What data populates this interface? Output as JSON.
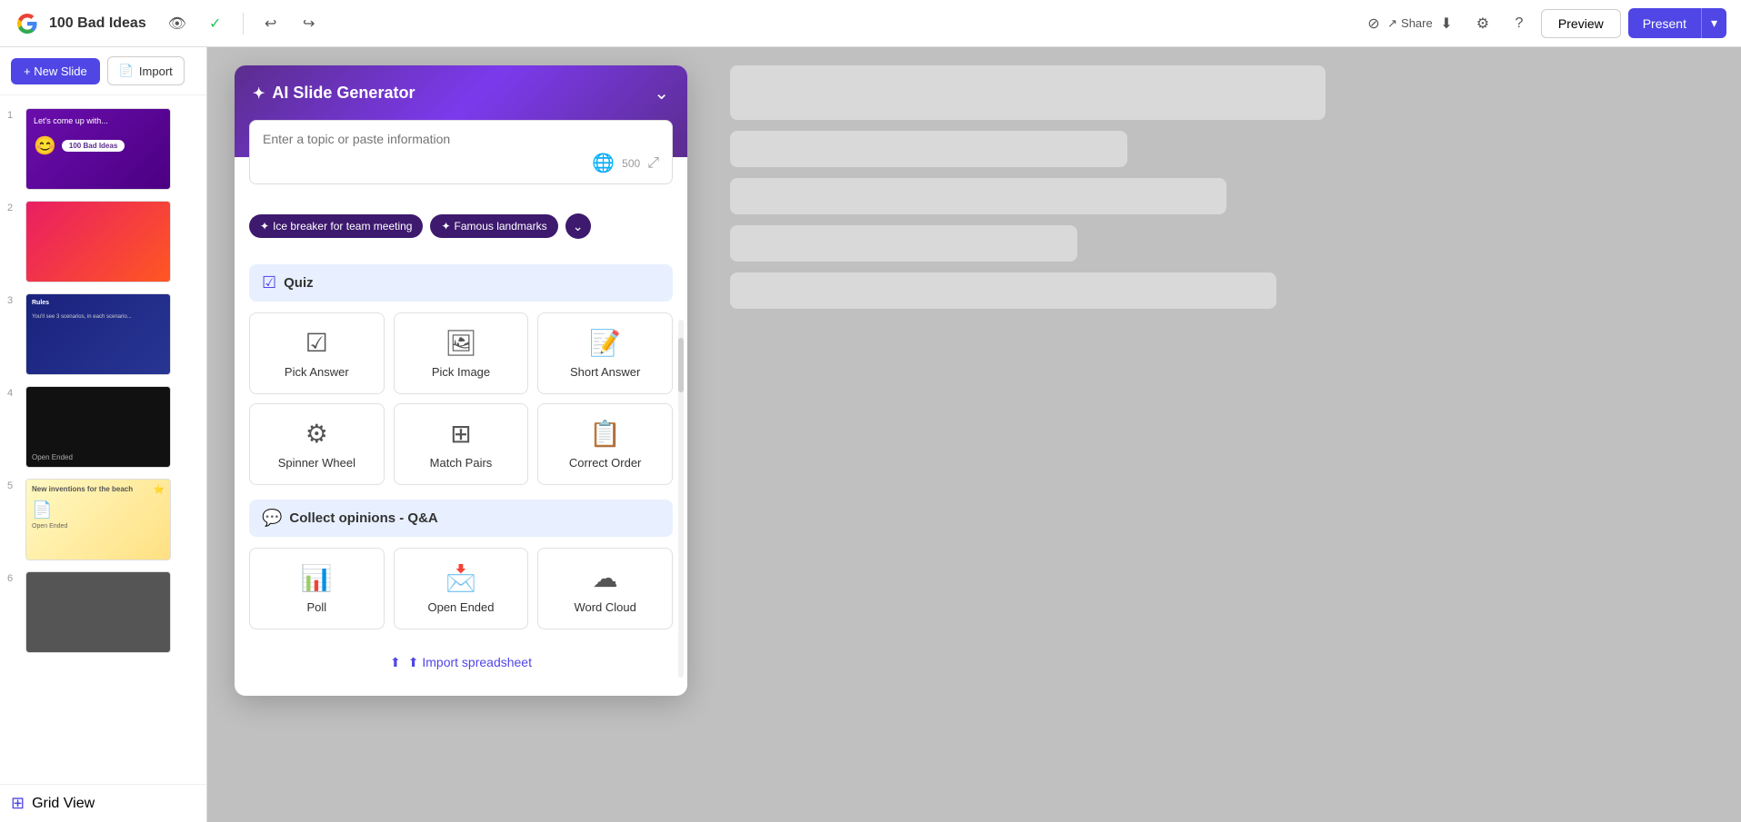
{
  "app": {
    "title": "100 Bad Ideas",
    "logo_text": "G"
  },
  "topbar": {
    "undo_label": "↩",
    "redo_label": "↪",
    "eye_label": "👁",
    "check_label": "✓",
    "share_label": "Share",
    "preview_label": "Preview",
    "present_label": "Present"
  },
  "sidebar": {
    "new_slide_label": "+ New Slide",
    "import_label": "Import",
    "grid_view_label": "Grid View",
    "slides": [
      {
        "number": "1",
        "label": "100 Bad Ideas",
        "theme": "slide-thumb-1"
      },
      {
        "number": "2",
        "label": "",
        "theme": "slide-thumb-2"
      },
      {
        "number": "3",
        "label": "",
        "theme": "slide-thumb-3"
      },
      {
        "number": "4",
        "label": "Open Ended",
        "theme": "slide-thumb-4"
      },
      {
        "number": "5",
        "label": "Open Ended",
        "theme": "slide-thumb-5"
      },
      {
        "number": "6",
        "label": "",
        "theme": "slide-thumb-6"
      }
    ]
  },
  "ai_panel": {
    "title": "AI Slide Generator",
    "sparkle": "✦",
    "input_placeholder": "Enter a topic or paste information",
    "char_count": "500",
    "suggestions": [
      {
        "label": "Ice breaker for team meeting"
      },
      {
        "label": "Famous landmarks"
      }
    ],
    "more_label": "⌄",
    "quiz_section": {
      "title": "Quiz",
      "items": [
        {
          "label": "Pick Answer",
          "icon": "☑"
        },
        {
          "label": "Pick Image",
          "icon": "🖼"
        },
        {
          "label": "Short Answer",
          "icon": "📝"
        },
        {
          "label": "Spinner Wheel",
          "icon": "⚙"
        },
        {
          "label": "Match Pairs",
          "icon": "⊞"
        },
        {
          "label": "Correct Order",
          "icon": "📋"
        }
      ]
    },
    "opinions_section": {
      "title": "Collect opinions - Q&A",
      "items": [
        {
          "label": "Poll",
          "icon": "📊"
        },
        {
          "label": "Open Ended",
          "icon": "📩"
        },
        {
          "label": "Word Cloud",
          "icon": "☁"
        }
      ]
    },
    "import_label": "⬆ Import spreadsheet"
  }
}
